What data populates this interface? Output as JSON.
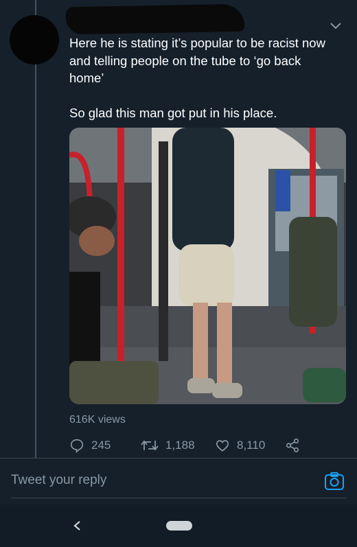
{
  "tweet": {
    "text": "Here he is stating it’s popular to be racist now\nand telling people on the tube to ‘go back\nhome’\n\nSo glad this man got put in his place.",
    "views": "616K views"
  },
  "actions": {
    "reply_count": "245",
    "retweet_count": "1,188",
    "like_count": "8,110"
  },
  "reply_box": {
    "placeholder": "Tweet your reply"
  },
  "colors": {
    "background": "#15202b",
    "secondary_text": "#8899a6",
    "accent": "#1da1f2",
    "divider": "#38444d"
  }
}
